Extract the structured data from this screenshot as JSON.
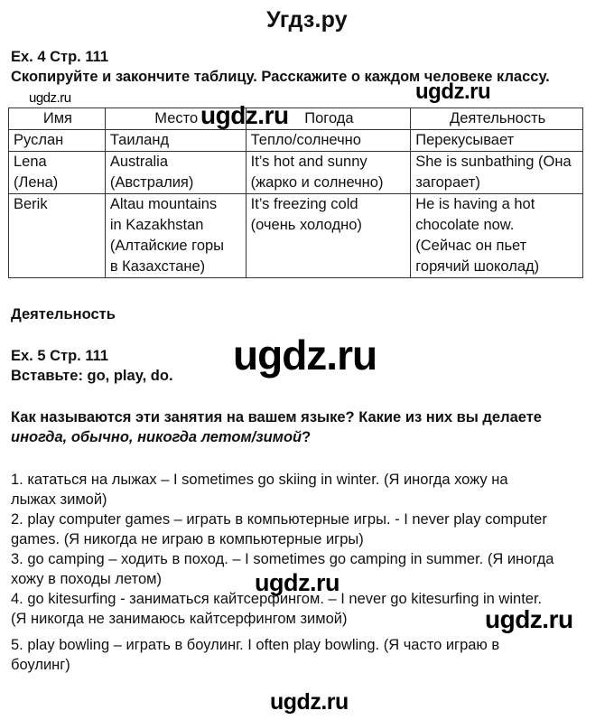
{
  "site_title": "Угдз.ру",
  "watermark_text": "ugdz.ru",
  "ex4": {
    "title": "Ex. 4 Стр. 111",
    "instruction": "Скопируйте и закончите таблицу. Расскажите о каждом человеке классу.",
    "table": {
      "headers": [
        "Имя",
        "Место",
        "Погода",
        "Деятельность"
      ],
      "rows": [
        {
          "name": [
            "Руслан"
          ],
          "place": [
            "Таиланд"
          ],
          "weather": [
            "Тепло/солнечно"
          ],
          "activity": [
            "Перекусывает"
          ]
        },
        {
          "name": [
            "Lena",
            "(Лена)"
          ],
          "place": [
            "Australia",
            "(Австралия)"
          ],
          "weather": [
            "It’s hot and sunny",
            "(жарко и солнечно)"
          ],
          "activity": [
            "She is sunbathing (Она",
            "загорает)"
          ]
        },
        {
          "name": [
            "Berik"
          ],
          "place": [
            "Altau mountains",
            "in Kazakhstan",
            "(Алтайские горы",
            "в Казахстане)"
          ],
          "weather": [
            "It’s freezing cold",
            "(очень холодно)"
          ],
          "activity": [
            "He is having a hot",
            "chocolate now.",
            "(Сейчас он пьет",
            "горячий шоколад)"
          ]
        }
      ]
    },
    "after_table_label": "Деятельность"
  },
  "ex5": {
    "title": "Ex. 5 Стр. 111",
    "instruction": "Вставьте: go, play, do.",
    "question_line1": "Как называются эти занятия на вашем языке? Какие из них вы делаете",
    "question_line2_italic": "иногда, обычно, никогда летом/зимой",
    "question_line2_end": "?",
    "answers": [
      [
        "1. кататься на лыжах – I sometimes go skiing in winter. (Я иногда хожу на",
        "лыжах зимой)"
      ],
      [
        "2. play computer games – играть в компьютерные игры. - I never play computer",
        "games. (Я никогда не играю в компьютерные игры)"
      ],
      [
        "3. go camping – ходить в поход. – I sometimes go camping in summer. (Я иногда",
        "хожу в походы летом)"
      ],
      [
        "4. go kitesurfing - заниматься кайтсерфингом. – I never go kitesurfing in winter.",
        "(Я никогда не занимаюсь кайтсерфингом зимой)"
      ],
      [
        "5. play bowling – играть в боулинг. I often play bowling. (Я часто играю в",
        "боулинг)"
      ]
    ]
  }
}
